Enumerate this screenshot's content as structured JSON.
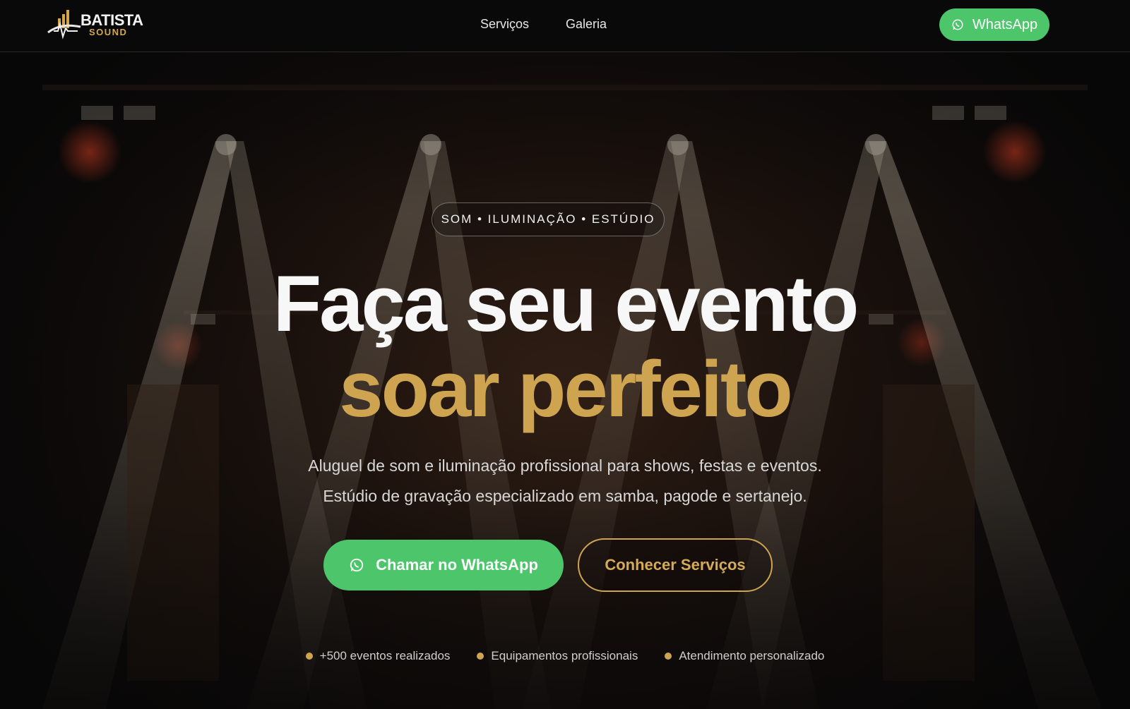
{
  "brand": {
    "name_line1": "BATISTA",
    "name_line2": "SOUND"
  },
  "nav": {
    "items": [
      {
        "label": "Serviços"
      },
      {
        "label": "Galeria"
      }
    ]
  },
  "header_cta": {
    "label": "WhatsApp",
    "icon": "whatsapp-icon"
  },
  "hero": {
    "badge": "SOM • ILUMINAÇÃO • ESTÚDIO",
    "title_line1": "Faça seu evento",
    "title_line2": "soar perfeito",
    "subtitle_line1": "Aluguel de som e iluminação profissional para shows, festas e eventos.",
    "subtitle_line2": "Estúdio de gravação especializado em samba, pagode e sertanejo.",
    "primary_cta": {
      "label": "Chamar no WhatsApp",
      "icon": "whatsapp-icon"
    },
    "secondary_cta": {
      "label": "Conhecer Serviços"
    },
    "stats": [
      {
        "label": "+500 eventos realizados"
      },
      {
        "label": "Equipamentos profissionais"
      },
      {
        "label": "Atendimento personalizado"
      }
    ]
  },
  "colors": {
    "accent_gold": "#cfa451",
    "whatsapp_green": "#4dc56b",
    "background": "#0b0908"
  }
}
